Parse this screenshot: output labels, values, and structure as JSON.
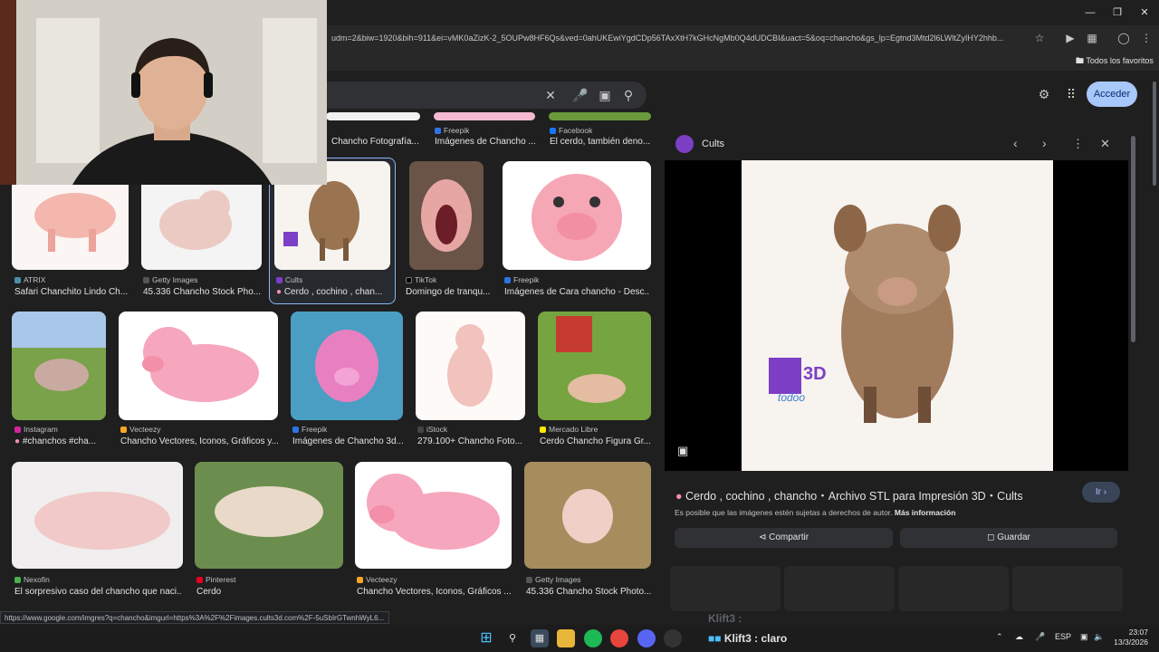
{
  "browser": {
    "url": "udm=2&biw=1920&bih=911&ei=vMK0aZizK-2_5OUPw8HF6Qs&ved=0ahUKEwiYgdCDp56TAxXtH7kGHcNgMb0Q4dUDCBI&uact=5&oq=chancho&gs_lp=Egtnd3Mtd2l6LWltZyIHY2hhb...",
    "favorites_label": "Todos los favoritos",
    "status_url": "https://www.google.com/imgres?q=chancho&imgurl=https%3A%2F%2Fimages.cults3d.com%2F-5uSbIrGTwnhWyL6..."
  },
  "header": {
    "acceder_label": "Acceder"
  },
  "top_row": [
    {
      "source": "",
      "caption": "Chancho Fotografía..."
    },
    {
      "source": "Freepik",
      "caption": "Imágenes de Chancho ..."
    },
    {
      "source": "Facebook",
      "caption": "El cerdo, también deno..."
    }
  ],
  "row1": [
    {
      "source": "ATRIX",
      "caption": "Safari Chanchito Lindo Ch..."
    },
    {
      "source": "Getty Images",
      "caption": "45.336 Chancho Stock Pho..."
    },
    {
      "source": "Cults",
      "caption": "Cerdo , cochino , chan..."
    },
    {
      "source": "TikTok",
      "caption": "Domingo de tranqu..."
    },
    {
      "source": "Freepik",
      "caption": "Imágenes de Cara chancho - Desc..."
    }
  ],
  "row2": [
    {
      "source": "Instagram",
      "caption": "#chanchos #cha..."
    },
    {
      "source": "Vecteezy",
      "caption": "Chancho Vectores, Iconos, Gráficos y..."
    },
    {
      "source": "Freepik",
      "caption": "Imágenes de Chancho 3d..."
    },
    {
      "source": "iStock",
      "caption": "279.100+ Chancho Foto..."
    },
    {
      "source": "Mercado Libre",
      "caption": "Cerdo Chancho Figura Gr..."
    }
  ],
  "row3": [
    {
      "source": "Nexofin",
      "caption": "El sorpresivo caso del chancho que naci..."
    },
    {
      "source": "Pinterest",
      "caption": "Cerdo"
    },
    {
      "source": "Vecteezy",
      "caption": "Chancho Vectores, Iconos, Gráficos ..."
    },
    {
      "source": "Getty Images",
      "caption": "45.336 Chancho Stock Photo..."
    }
  ],
  "panel": {
    "site": "Cults",
    "title": "Cerdo , cochino , chancho・Archivo STL para Impresión 3D・Cults",
    "ir_label": "Ir",
    "copyright": "Es posible que las imágenes estén sujetas a derechos de autor.",
    "more_info": "Más información",
    "share_label": "Compartir",
    "save_label": "Guardar",
    "logo_text": "3D",
    "logo_sub": "todoo"
  },
  "taskbar": {
    "app_label": "Klift3 : claro",
    "lang": "ESP",
    "time": "23:07",
    "date": "13/3/2026"
  },
  "overlay_text": "Klift3 :"
}
